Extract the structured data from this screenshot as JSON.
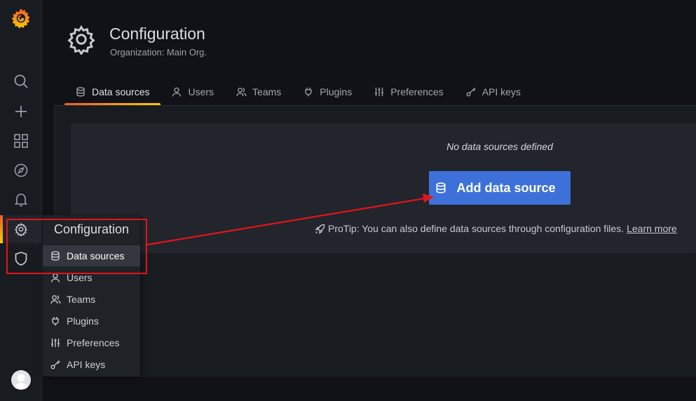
{
  "header": {
    "title": "Configuration",
    "subtitle": "Organization: Main Org."
  },
  "tabs": [
    {
      "label": "Data sources",
      "icon": "database-icon",
      "active": true
    },
    {
      "label": "Users",
      "icon": "user-icon"
    },
    {
      "label": "Teams",
      "icon": "users-icon"
    },
    {
      "label": "Plugins",
      "icon": "plug-icon"
    },
    {
      "label": "Preferences",
      "icon": "sliders-icon"
    },
    {
      "label": "API keys",
      "icon": "key-icon"
    }
  ],
  "empty_state": {
    "message": "No data sources defined",
    "button_label": "Add data source",
    "protip_text": "ProTip: You can also define data sources through configuration files.",
    "protip_link": "Learn more"
  },
  "sidebar": {
    "items": [
      {
        "icon": "grafana-logo-icon"
      },
      {
        "icon": "search-icon"
      },
      {
        "icon": "plus-icon"
      },
      {
        "icon": "dashboards-grid-icon"
      },
      {
        "icon": "compass-icon"
      },
      {
        "icon": "bell-icon"
      },
      {
        "icon": "gear-icon",
        "active": true
      },
      {
        "icon": "shield-icon"
      },
      {
        "icon": "avatar-icon"
      }
    ]
  },
  "flyout": {
    "title": "Configuration",
    "items": [
      {
        "label": "Data sources",
        "icon": "database-icon",
        "active": true
      },
      {
        "label": "Users",
        "icon": "user-icon"
      },
      {
        "label": "Teams",
        "icon": "users-icon"
      },
      {
        "label": "Plugins",
        "icon": "plug-icon"
      },
      {
        "label": "Preferences",
        "icon": "sliders-icon"
      },
      {
        "label": "API keys",
        "icon": "key-icon"
      }
    ]
  },
  "colors": {
    "accent_gradient_start": "#f05a28",
    "accent_gradient_end": "#fbca0a",
    "primary_button": "#3d71d9",
    "annotation": "#e2141c"
  }
}
